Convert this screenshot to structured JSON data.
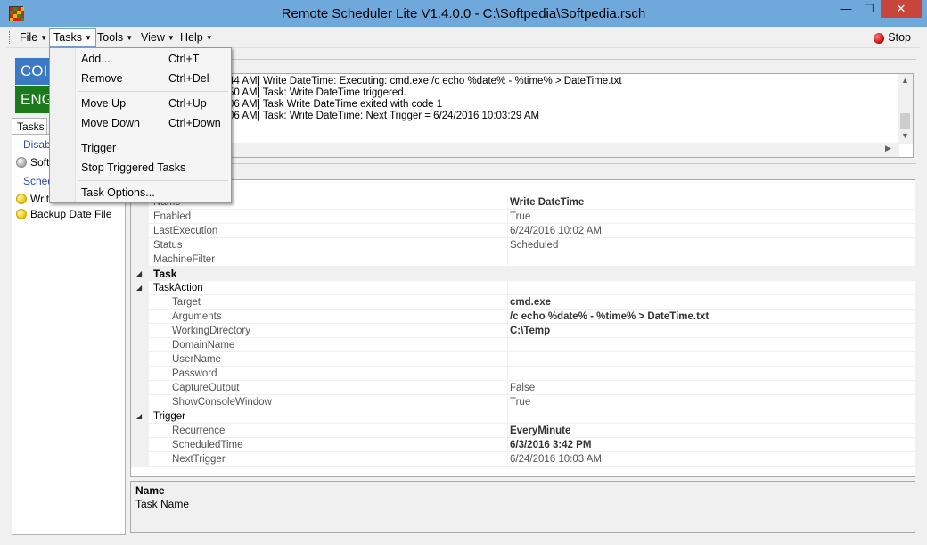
{
  "window": {
    "title": "Remote Scheduler Lite V1.4.0.0 - C:\\Softpedia\\Softpedia.rsch",
    "minimize": "—",
    "maximize": "☐",
    "close": "✕"
  },
  "menubar": {
    "items": [
      {
        "label": "File"
      },
      {
        "label": "Tasks"
      },
      {
        "label": "Tools"
      },
      {
        "label": "View"
      },
      {
        "label": "Help"
      }
    ],
    "stop_label": "Stop"
  },
  "left": {
    "logo_top": "COI",
    "logo_bottom": "ENG",
    "tab_label": "Tasks",
    "tree": [
      {
        "label": "Disab",
        "kind": "group"
      },
      {
        "label": "Softp",
        "kind": "task",
        "status": "grey"
      },
      {
        "label": "Sched",
        "kind": "group"
      },
      {
        "label": "Write",
        "kind": "task",
        "status": "yellow"
      },
      {
        "label": "Backup Date File",
        "kind": "task",
        "status": "yellow"
      }
    ]
  },
  "log": {
    "lines": [
      "44 AM] Write DateTime: Executing: cmd.exe /c echo %date% - %time% > DateTime.txt",
      "50 AM] Task: Write DateTime triggered.",
      "06 AM] Task Write DateTime exited with code 1",
      "06 AM] Task: Write DateTime: Next Trigger = 6/24/2016 10:03:29 AM"
    ]
  },
  "properties": {
    "rows": [
      {
        "name": "Name",
        "value": "Write DateTime",
        "bold": true,
        "type": "prop",
        "indent": 1
      },
      {
        "name": "Enabled",
        "value": "True",
        "bold": false,
        "type": "prop",
        "indent": 1
      },
      {
        "name": "LastExecution",
        "value": "6/24/2016 10:02 AM",
        "bold": false,
        "type": "prop",
        "indent": 1
      },
      {
        "name": "Status",
        "value": "Scheduled",
        "bold": false,
        "type": "prop",
        "indent": 1
      },
      {
        "name": "MachineFilter",
        "value": "",
        "bold": false,
        "type": "prop",
        "indent": 1
      },
      {
        "name": "Task",
        "value": "",
        "bold": false,
        "type": "category",
        "indent": 1
      },
      {
        "name": "TaskAction",
        "value": "",
        "bold": false,
        "type": "subcategory",
        "indent": 1
      },
      {
        "name": "Target",
        "value": "cmd.exe",
        "bold": true,
        "type": "prop",
        "indent": 2
      },
      {
        "name": "Arguments",
        "value": "/c echo %date% - %time% > DateTime.txt",
        "bold": true,
        "type": "prop",
        "indent": 2
      },
      {
        "name": "WorkingDirectory",
        "value": "C:\\Temp",
        "bold": true,
        "type": "prop",
        "indent": 2
      },
      {
        "name": "DomainName",
        "value": "",
        "bold": false,
        "type": "prop",
        "indent": 2
      },
      {
        "name": "UserName",
        "value": "",
        "bold": false,
        "type": "prop",
        "indent": 2
      },
      {
        "name": "Password",
        "value": "",
        "bold": false,
        "type": "prop",
        "indent": 2
      },
      {
        "name": "CaptureOutput",
        "value": "False",
        "bold": false,
        "type": "prop",
        "indent": 2
      },
      {
        "name": "ShowConsoleWindow",
        "value": "True",
        "bold": false,
        "type": "prop",
        "indent": 2
      },
      {
        "name": "Trigger",
        "value": "",
        "bold": false,
        "type": "subcategory",
        "indent": 1
      },
      {
        "name": "Recurrence",
        "value": "EveryMinute",
        "bold": true,
        "type": "prop",
        "indent": 2
      },
      {
        "name": "ScheduledTime",
        "value": "6/3/2016 3:42 PM",
        "bold": true,
        "type": "prop",
        "indent": 2
      },
      {
        "name": "NextTrigger",
        "value": "6/24/2016 10:03 AM",
        "bold": false,
        "type": "prop",
        "indent": 2
      }
    ]
  },
  "help": {
    "title": "Name",
    "description": "Task Name"
  },
  "tasks_menu": {
    "items": [
      {
        "label": "Add...",
        "shortcut": "Ctrl+T"
      },
      {
        "label": "Remove",
        "shortcut": "Ctrl+Del"
      },
      {
        "label": "Move Up",
        "shortcut": "Ctrl+Up"
      },
      {
        "label": "Move Down",
        "shortcut": "Ctrl+Down"
      },
      {
        "label": "Trigger",
        "shortcut": ""
      },
      {
        "label": "Stop Triggered Tasks",
        "shortcut": ""
      },
      {
        "label": "Task Options...",
        "shortcut": ""
      }
    ]
  },
  "colors": {
    "titlebar": "#6fa9dc",
    "close_button": "#c7453b",
    "logo_blue": "#3b79c2",
    "logo_green": "#1b7a1b"
  }
}
